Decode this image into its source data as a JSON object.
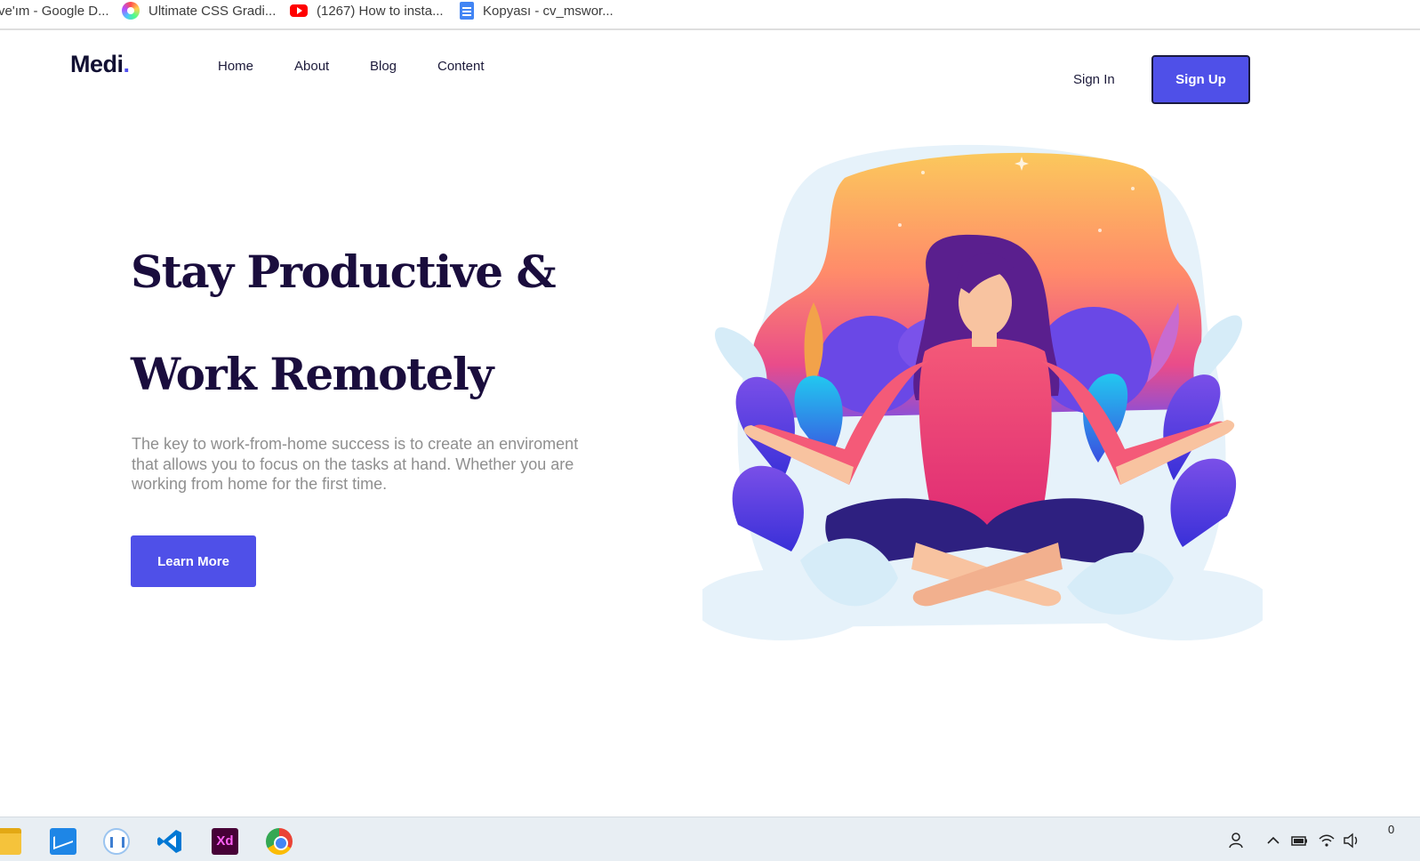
{
  "bookmarks": [
    {
      "label": "ve'ım - Google D...",
      "icon": "google-drive-icon"
    },
    {
      "label": "Ultimate CSS Gradi...",
      "icon": "gradient-icon"
    },
    {
      "label": "(1267) How to insta...",
      "icon": "youtube-icon"
    },
    {
      "label": "Kopyası - cv_mswor...",
      "icon": "google-docs-icon"
    }
  ],
  "header": {
    "logo_text": "Medi",
    "logo_dot": ".",
    "nav": [
      "Home",
      "About",
      "Blog",
      "Content"
    ],
    "signin_label": "Sign In",
    "signup_label": "Sign Up"
  },
  "hero": {
    "title_line1": "Stay Productive &",
    "title_line2": "Work Remotely",
    "description": "The key to work-from-home success is to create an enviroment that allows you to focus on the tasks at hand. Whether you are working from home for the first time.",
    "cta_label": "Learn More",
    "illustration_icon": "meditating-woman-illustration"
  },
  "taskbar": {
    "apps": [
      "file-explorer-icon",
      "mail-icon",
      "ink-icon",
      "vscode-icon",
      "adobe-xd-icon",
      "chrome-icon"
    ],
    "xd_label": "Xd",
    "tray": [
      "people-icon",
      "chevron-up-icon",
      "battery-icon",
      "wifi-icon",
      "volume-icon"
    ],
    "clock_fragment": "0"
  },
  "colors": {
    "accent": "#4f50e8",
    "heading": "#1a0d3d",
    "body_text": "#8f8f8f"
  }
}
